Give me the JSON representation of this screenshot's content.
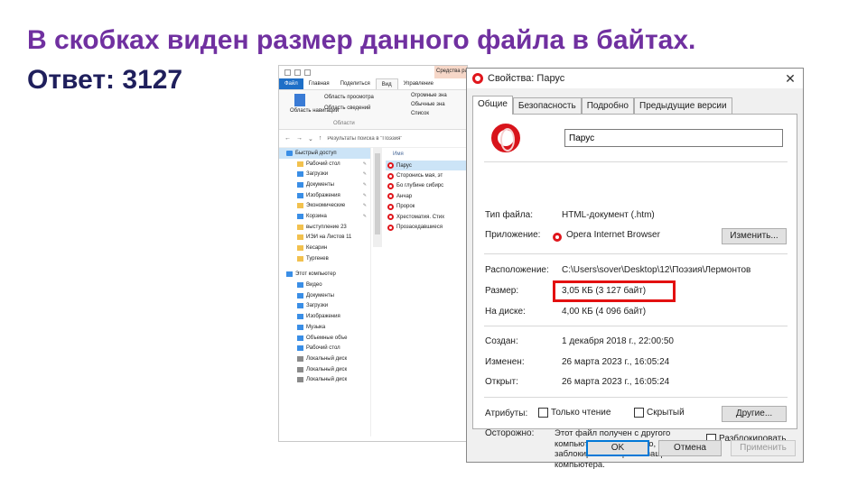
{
  "slide": {
    "title": "В скобках виден размер данного файла в байтах.",
    "answer": "Ответ: 3127"
  },
  "explorer": {
    "context_tab": "Средства раб",
    "ribbon_tabs": [
      "Файл",
      "Главная",
      "Поделиться",
      "Вид",
      "Управление"
    ],
    "ribbon": {
      "pane_button": "Область навигации",
      "preview_pane": "Область просмотра",
      "details_pane": "Область сведений",
      "group_label": "Области",
      "huge_icons": "Огромные зна",
      "large_icons": "Обычные зна",
      "list": "Список"
    },
    "address_path": "Результаты поиска в \"Поэзия\"",
    "nav_items": [
      {
        "label": "Быстрый доступ",
        "icon": "star-icon",
        "pinned": false,
        "top": true,
        "selected": true
      },
      {
        "label": "Рабочий стол",
        "icon": "folder-icon",
        "pinned": true
      },
      {
        "label": "Загрузки",
        "icon": "download-icon",
        "pinned": true
      },
      {
        "label": "Документы",
        "icon": "documents-icon",
        "pinned": true
      },
      {
        "label": "Изображения",
        "icon": "pictures-icon",
        "pinned": true
      },
      {
        "label": "Экономические",
        "icon": "folder-icon",
        "pinned": true
      },
      {
        "label": "Корзина",
        "icon": "recycle-bin-icon",
        "pinned": true
      },
      {
        "label": "выступление 23",
        "icon": "folder-icon",
        "pinned": false
      },
      {
        "label": "ИЭИ на Листов 11",
        "icon": "folder-icon",
        "pinned": false
      },
      {
        "label": "Кесарин",
        "icon": "folder-icon",
        "pinned": false
      },
      {
        "label": "Тургенев",
        "icon": "folder-icon",
        "pinned": false
      },
      {
        "label": "Этот компьютер",
        "icon": "computer-icon",
        "pinned": false,
        "top": true
      },
      {
        "label": "Видео",
        "icon": "video-icon",
        "pinned": false
      },
      {
        "label": "Документы",
        "icon": "documents-icon",
        "pinned": false
      },
      {
        "label": "Загрузки",
        "icon": "download-icon",
        "pinned": false
      },
      {
        "label": "Изображения",
        "icon": "pictures-icon",
        "pinned": false
      },
      {
        "label": "Музыка",
        "icon": "music-icon",
        "pinned": false
      },
      {
        "label": "Объемные объе",
        "icon": "3d-objects-icon",
        "pinned": false
      },
      {
        "label": "Рабочий стол",
        "icon": "desktop-icon",
        "pinned": false
      },
      {
        "label": "Локальный диск",
        "icon": "drive-icon",
        "pinned": false
      },
      {
        "label": "Локальный диск",
        "icon": "drive-icon",
        "pinned": false
      },
      {
        "label": "Локальный диск",
        "icon": "drive-icon",
        "pinned": false
      }
    ],
    "files_header": "Имя",
    "files": [
      {
        "label": "Парус",
        "selected": true
      },
      {
        "label": "Сторонись мая, эт"
      },
      {
        "label": "Бо глубине сибирс"
      },
      {
        "label": "Анчар"
      },
      {
        "label": "Пророк"
      },
      {
        "label": "Хрестоматия. Стих"
      },
      {
        "label": "Прозаседавшиеся"
      }
    ]
  },
  "dialog": {
    "title": "Свойства: Парус",
    "close_label": "✕",
    "tabs": [
      "Общие",
      "Безопасность",
      "Подробно",
      "Предыдущие версии"
    ],
    "active_tab": 0,
    "file_name": "Парус",
    "fields": {
      "file_type_label": "Тип файла:",
      "file_type_value": "HTML-документ (.htm)",
      "app_label": "Приложение:",
      "app_value": "Opera Internet Browser",
      "change_button": "Изменить...",
      "location_label": "Расположение:",
      "location_value": "C:\\Users\\sover\\Desktop\\12\\Поэзия\\Лермонтов",
      "size_label": "Размер:",
      "size_value": "3,05 КБ (3 127 байт)",
      "disk_size_label": "На диске:",
      "disk_size_value": "4,00 КБ (4 096 байт)",
      "created_label": "Создан:",
      "created_value": "1 декабря 2018 г., 22:00:50",
      "modified_label": "Изменен:",
      "modified_value": "26 марта 2023 г., 16:05:24",
      "opened_label": "Открыт:",
      "opened_value": "26 марта 2023 г., 16:05:24",
      "attributes_label": "Атрибуты:",
      "readonly_label": "Только чтение",
      "hidden_label": "Скрытый",
      "other_button": "Другие...",
      "caution_label": "Осторожно:",
      "caution_text": "Этот файл получен с другого компьютера и, возможно, был заблокирован с целью защиты компьютера.",
      "unblock_label": "Разблокировать"
    },
    "buttons": {
      "ok": "OK",
      "cancel": "Отмена",
      "apply": "Применить"
    }
  },
  "colors": {
    "title_purple": "#7030a0",
    "answer_navy": "#1f1f5c",
    "highlight_red": "#e31010",
    "opera_red": "#e0161c"
  }
}
